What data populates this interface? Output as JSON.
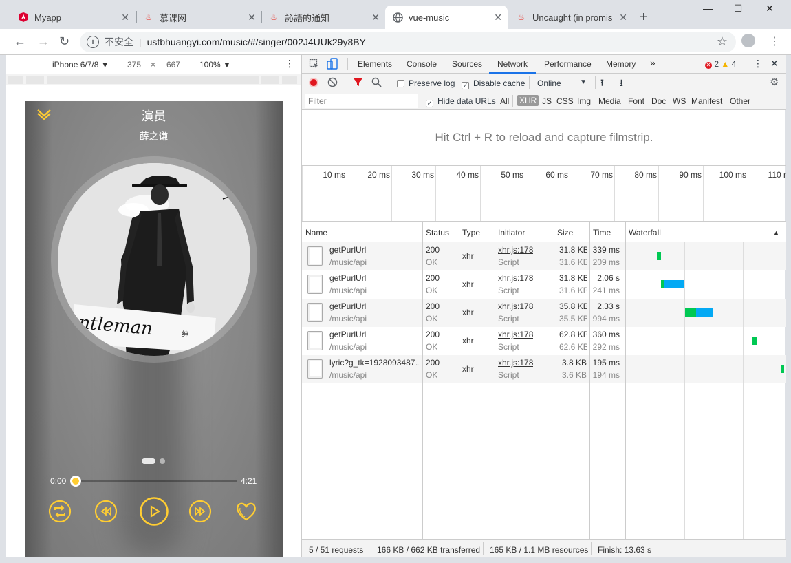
{
  "tabs": [
    {
      "label": "Myapp",
      "icon": "angular-icon",
      "active": false
    },
    {
      "label": "慕课网",
      "icon": "flame-icon",
      "active": false
    },
    {
      "label": "訫語的通知",
      "icon": "flame-icon",
      "active": false
    },
    {
      "label": "vue-music",
      "icon": "globe-icon",
      "active": true
    },
    {
      "label": "Uncaught (in promis",
      "icon": "flame-icon",
      "active": false
    }
  ],
  "omnibox": {
    "security": "不安全",
    "url": "ustbhuangyi.com/music/#/singer/002J4UUk29y8BY"
  },
  "device": {
    "name": "iPhone 6/7/8 ▼",
    "width": "375",
    "times": "×",
    "height": "667",
    "zoom": "100% ▼"
  },
  "player": {
    "title": "演员",
    "singer": "薛之谦",
    "time_current": "0:00",
    "time_total": "4:21",
    "progress": 0,
    "accent": "#ffcd32"
  },
  "devtools": {
    "tabs": [
      "Elements",
      "Console",
      "Sources",
      "Network",
      "Performance",
      "Memory",
      "»"
    ],
    "selected_tab": "Network",
    "errors": "2",
    "warnings": "4",
    "preserve_log": "Preserve log",
    "disable_cache": "Disable cache",
    "throttle": "Online",
    "filter_placeholder": "Filter",
    "hide_data_urls": "Hide data URLs",
    "filter_types": [
      "All",
      "XHR",
      "JS",
      "CSS",
      "Img",
      "Media",
      "Font",
      "Doc",
      "WS",
      "Manifest",
      "Other"
    ],
    "selected_type": "XHR",
    "hint": "Hit Ctrl + R to reload and capture filmstrip.",
    "overview_ticks": [
      "10 ms",
      "20 ms",
      "30 ms",
      "40 ms",
      "50 ms",
      "60 ms",
      "70 ms",
      "80 ms",
      "90 ms",
      "100 ms",
      "110 r"
    ],
    "columns": [
      "Name",
      "Status",
      "Type",
      "Initiator",
      "Size",
      "Time",
      "Waterfall"
    ],
    "rows": [
      {
        "name": "getPurlUrl",
        "path": "/music/api",
        "status": "200",
        "status_text": "OK",
        "type": "xhr",
        "initiator": "xhr.js:178",
        "initiator_sub": "Script",
        "size": "31.8 KB",
        "size_sub": "31.6 KB",
        "time": "339 ms",
        "time_sub": "209 ms"
      },
      {
        "name": "getPurlUrl",
        "path": "/music/api",
        "status": "200",
        "status_text": "OK",
        "type": "xhr",
        "initiator": "xhr.js:178",
        "initiator_sub": "Script",
        "size": "31.8 KB",
        "size_sub": "31.6 KB",
        "time": "2.06 s",
        "time_sub": "241 ms"
      },
      {
        "name": "getPurlUrl",
        "path": "/music/api",
        "status": "200",
        "status_text": "OK",
        "type": "xhr",
        "initiator": "xhr.js:178",
        "initiator_sub": "Script",
        "size": "35.8 KB",
        "size_sub": "35.5 KB",
        "time": "2.33 s",
        "time_sub": "994 ms"
      },
      {
        "name": "getPurlUrl",
        "path": "/music/api",
        "status": "200",
        "status_text": "OK",
        "type": "xhr",
        "initiator": "xhr.js:178",
        "initiator_sub": "Script",
        "size": "62.8 KB",
        "size_sub": "62.6 KB",
        "time": "360 ms",
        "time_sub": "292 ms"
      },
      {
        "name": "lyric?g_tk=1928093487…",
        "path": "/music/api",
        "status": "200",
        "status_text": "OK",
        "type": "xhr",
        "initiator": "xhr.js:178",
        "initiator_sub": "Script",
        "size": "3.8 KB",
        "size_sub": "3.6 KB",
        "time": "195 ms",
        "time_sub": "194 ms"
      }
    ],
    "status": {
      "requests": "5 / 51 requests",
      "transferred": "166 KB / 662 KB transferred",
      "resources": "165 KB / 1.1 MB resources",
      "finish": "Finish: 13.63 s"
    },
    "colors": {
      "waiting": "#00c853",
      "download": "#03a9f4",
      "active_tab": "#1a73e8",
      "record": "#e0161f"
    }
  }
}
